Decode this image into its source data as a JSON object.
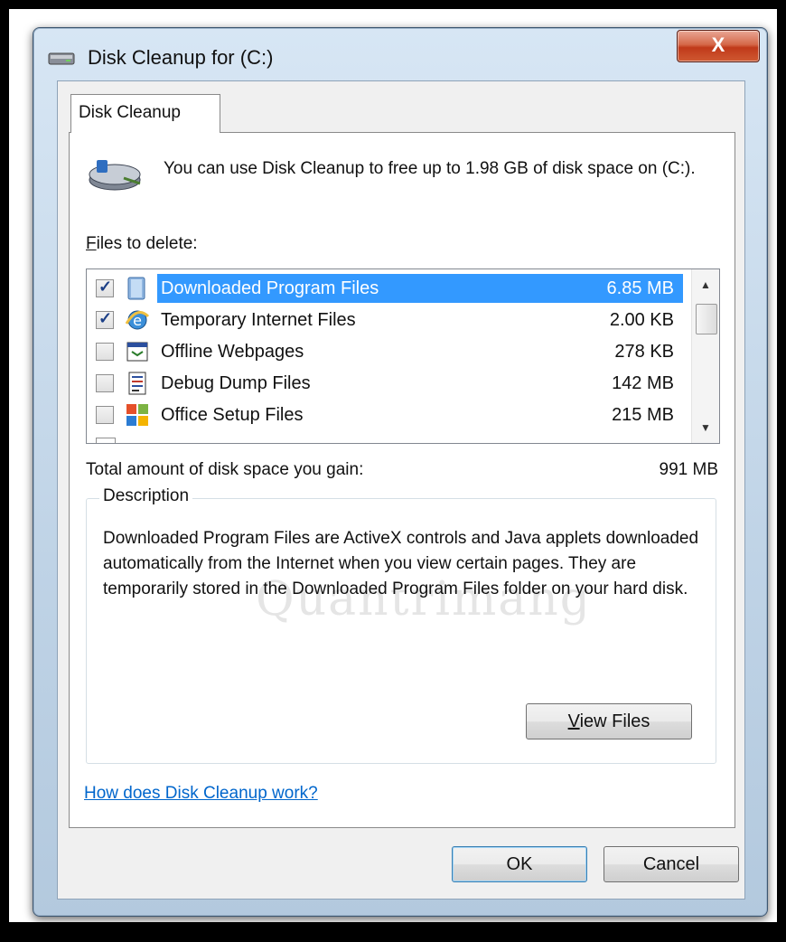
{
  "window": {
    "title": "Disk Cleanup for  (C:)",
    "close_label": "X"
  },
  "tab": {
    "label": "Disk Cleanup"
  },
  "info": {
    "text": "You can use Disk Cleanup to free up to 1.98 GB of disk space on  (C:)."
  },
  "files_label_accel": "F",
  "files_label_rest": "iles to delete:",
  "files": [
    {
      "name": "Downloaded Program Files",
      "size": "6.85 MB",
      "checked": true,
      "selected": true,
      "icon": "folder-icon"
    },
    {
      "name": "Temporary Internet Files",
      "size": "2.00 KB",
      "checked": true,
      "selected": false,
      "icon": "internet-explorer-icon"
    },
    {
      "name": "Offline Webpages",
      "size": "278 KB",
      "checked": false,
      "selected": false,
      "icon": "offline-webpage-icon"
    },
    {
      "name": "Debug Dump Files",
      "size": "142 MB",
      "checked": false,
      "selected": false,
      "icon": "dump-file-icon"
    },
    {
      "name": "Office Setup Files",
      "size": "215 MB",
      "checked": false,
      "selected": false,
      "icon": "office-setup-icon"
    }
  ],
  "total": {
    "label": "Total amount of disk space you gain:",
    "value": "991 MB"
  },
  "description": {
    "legend": "Description",
    "text": "Downloaded Program Files are ActiveX controls and Java applets downloaded automatically from the Internet when you view certain pages. They are temporarily stored in the Downloaded Program Files folder on your hard disk."
  },
  "view_files_accel": "V",
  "view_files_rest": "iew Files",
  "help_link": "How does Disk Cleanup work?",
  "ok_label": "OK",
  "cancel_label": "Cancel",
  "watermark": "Quantrimang",
  "colors": {
    "selection": "#3399ff",
    "link": "#0066cc",
    "close": "#c0391a"
  }
}
